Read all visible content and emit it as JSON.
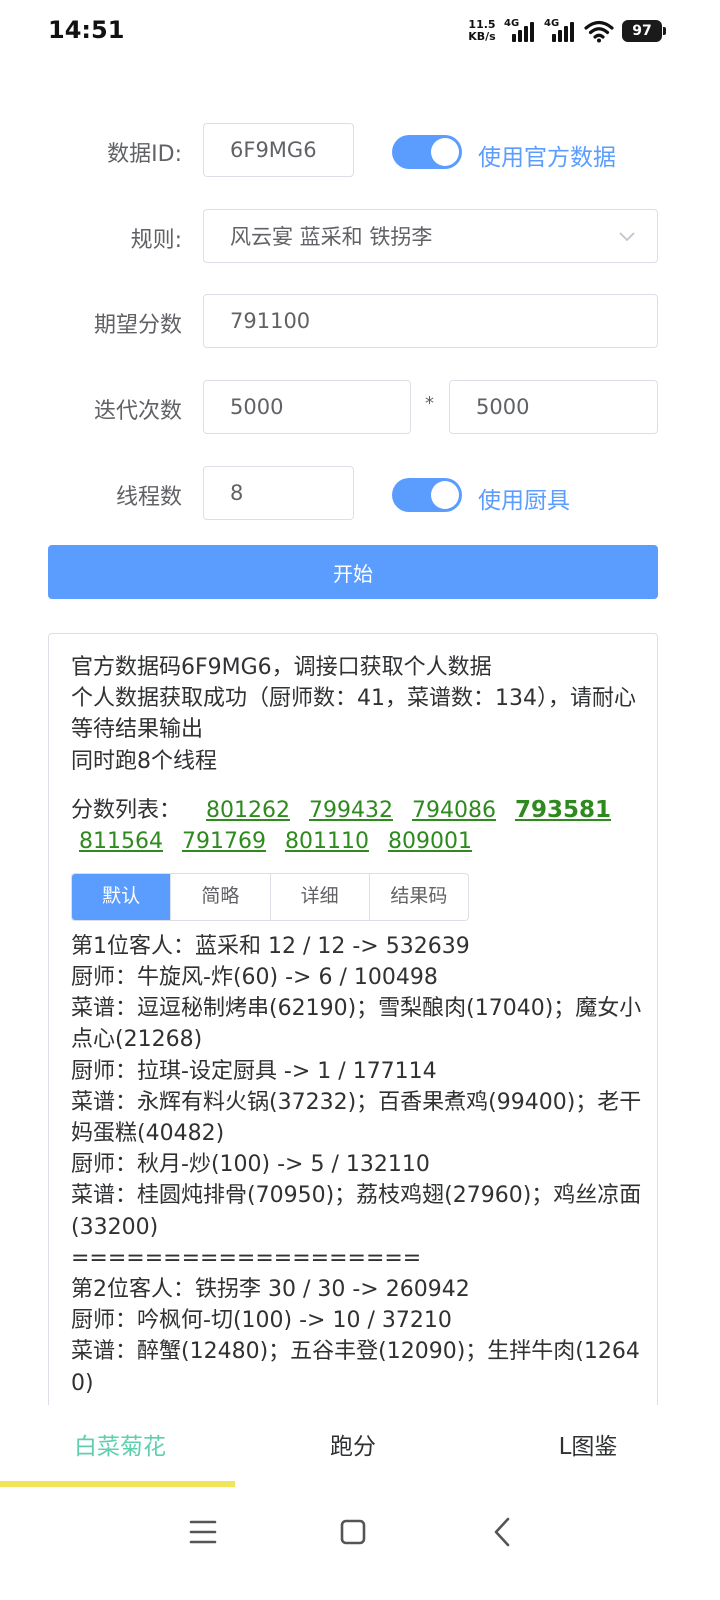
{
  "status": {
    "time": "14:51",
    "net_speed_top": "11.5",
    "net_speed_bottom": "KB/s",
    "sim1": "4G",
    "sim2": "4G",
    "battery": "97"
  },
  "form": {
    "data_id_label": "数据ID:",
    "data_id_value": "6F9MG6",
    "official_switch_label": "使用官方数据",
    "rule_label": "规则:",
    "rule_value": "风云宴 蓝采和 铁拐李",
    "score_label": "期望分数",
    "score_value": "791100",
    "iter_label": "迭代次数",
    "iter_value_1": "5000",
    "iter_star": "*",
    "iter_value_2": "5000",
    "thread_label": "线程数",
    "thread_value": "8",
    "tools_switch_label": "使用厨具",
    "start_label": "开始"
  },
  "result": {
    "log": [
      "官方数据码6F9MG6，调接口获取个人数据",
      "个人数据获取成功（厨师数：41，菜谱数：134），请耐心等待结果输出",
      "同时跑8个线程"
    ],
    "scores_label": "分数列表：",
    "scores": [
      "801262",
      "799432",
      "794086",
      "793581",
      "811564",
      "791769",
      "801110",
      "809001"
    ],
    "tabs": [
      "默认",
      "简略",
      "详细",
      "结果码"
    ],
    "detail": [
      "第1位客人：蓝采和 12 / 12 -> 532639",
      "厨师：牛旋风-炸(60) -> 6 / 100498",
      "菜谱：逗逗秘制烤串(62190)；雪梨酿肉(17040)；魔女小点心(21268)",
      "厨师：拉琪-设定厨具 -> 1 / 177114",
      "菜谱：永辉有料火锅(37232)；百香果煮鸡(99400)；老干妈蛋糕(40482)",
      "厨师：秋月-炒(100) -> 5 / 132110",
      "菜谱：桂圆炖排骨(70950)；荔枝鸡翅(27960)；鸡丝凉面(33200)",
      "===================",
      "第2位客人：铁拐李 30 / 30 -> 260942",
      "厨师：吟枫何-切(100) -> 10 / 37210",
      "菜谱：醉蟹(12480)；五谷丰登(12090)；生拌牛肉(12640)"
    ]
  },
  "bottom_nav": [
    "白菜菊花",
    "跑分",
    "L图鉴"
  ],
  "colors": {
    "accent": "#5b9dff",
    "score_link": "#2e8a1e",
    "active_tab": "#5fcfb0",
    "indicator": "#f3e55a"
  }
}
